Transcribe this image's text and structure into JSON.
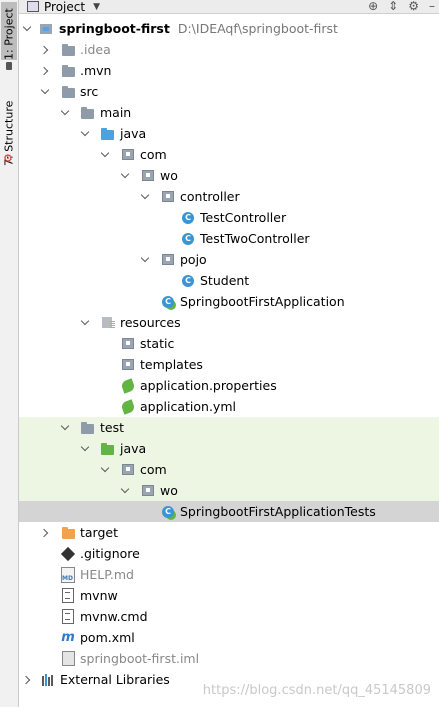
{
  "sidebar": {
    "project_tab": "1: Project",
    "structure_tab": "7: Structure"
  },
  "header": {
    "title": "Project"
  },
  "tree": {
    "root": {
      "name": "springboot-first",
      "path": "D:\\IDEAqf\\springboot-first"
    },
    "idea": ".idea",
    "mvn": ".mvn",
    "src": "src",
    "main": "main",
    "main_java": "java",
    "main_com": "com",
    "main_wo": "wo",
    "controller": "controller",
    "test_controller": "TestController",
    "test_two_controller": "TestTwoController",
    "pojo": "pojo",
    "student": "Student",
    "app_class": "SpringbootFirstApplication",
    "resources": "resources",
    "static": "static",
    "templates": "templates",
    "app_properties": "application.properties",
    "app_yml": "application.yml",
    "test": "test",
    "test_java": "java",
    "test_com": "com",
    "test_wo": "wo",
    "app_tests": "SpringbootFirstApplicationTests",
    "target": "target",
    "gitignore": ".gitignore",
    "help_md": "HELP.md",
    "mvnw": "mvnw",
    "mvnw_cmd": "mvnw.cmd",
    "pom": "pom.xml",
    "iml": "springboot-first.iml",
    "external_libraries": "External Libraries"
  },
  "watermark": "https://blog.csdn.net/qq_45145809",
  "colors": {
    "selected_row": "#d4d4d4",
    "test_tint": "#edf6e3",
    "source_folder": "#4aa3e0",
    "test_folder": "#62b543",
    "excluded_folder": "#f2a24a"
  }
}
